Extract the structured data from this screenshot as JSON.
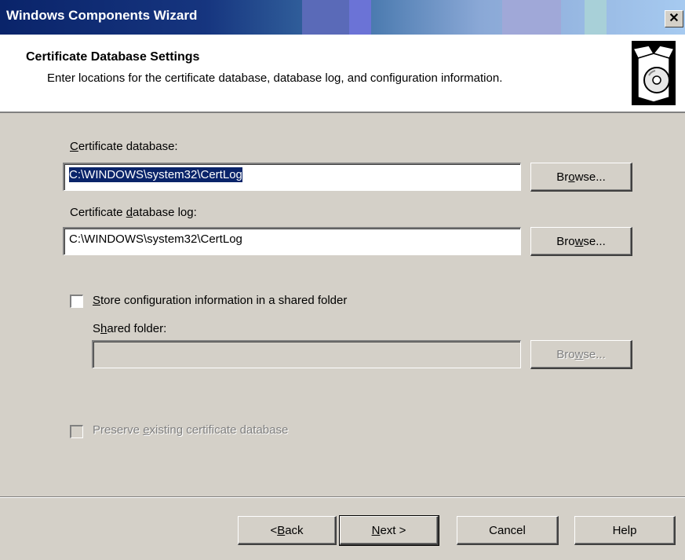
{
  "window": {
    "title": "Windows Components Wizard",
    "close_glyph": "✕"
  },
  "header": {
    "title": "Certificate Database Settings",
    "description": "Enter locations for the certificate database, database log, and configuration information.",
    "icon": "cd-box-icon"
  },
  "form": {
    "db_label_pre": "",
    "db_label_ul": "C",
    "db_label_post": "ertificate database:",
    "db_value": "C:\\WINDOWS\\system32\\CertLog",
    "db_browse_pre": "Br",
    "db_browse_ul": "o",
    "db_browse_post": "wse...",
    "log_label_pre": "Certificate ",
    "log_label_ul": "d",
    "log_label_post": "atabase log:",
    "log_value": "C:\\WINDOWS\\system32\\CertLog",
    "log_browse_pre": "Bro",
    "log_browse_ul": "w",
    "log_browse_post": "se...",
    "shared_checkbox_pre": "",
    "shared_checkbox_ul": "S",
    "shared_checkbox_post": "tore configuration information in a shared folder",
    "shared_folder_pre": "S",
    "shared_folder_ul": "h",
    "shared_folder_post": "ared folder:",
    "shared_value": "",
    "shared_browse_pre": "Bro",
    "shared_browse_ul": "w",
    "shared_browse_post": "se...",
    "preserve_pre": "Preserve ",
    "preserve_ul": "e",
    "preserve_post": "xisting certificate database"
  },
  "footer": {
    "back_pre": "< ",
    "back_ul": "B",
    "back_post": "ack",
    "next_ul": "N",
    "next_post": "ext >",
    "cancel": "Cancel",
    "help": "Help"
  }
}
